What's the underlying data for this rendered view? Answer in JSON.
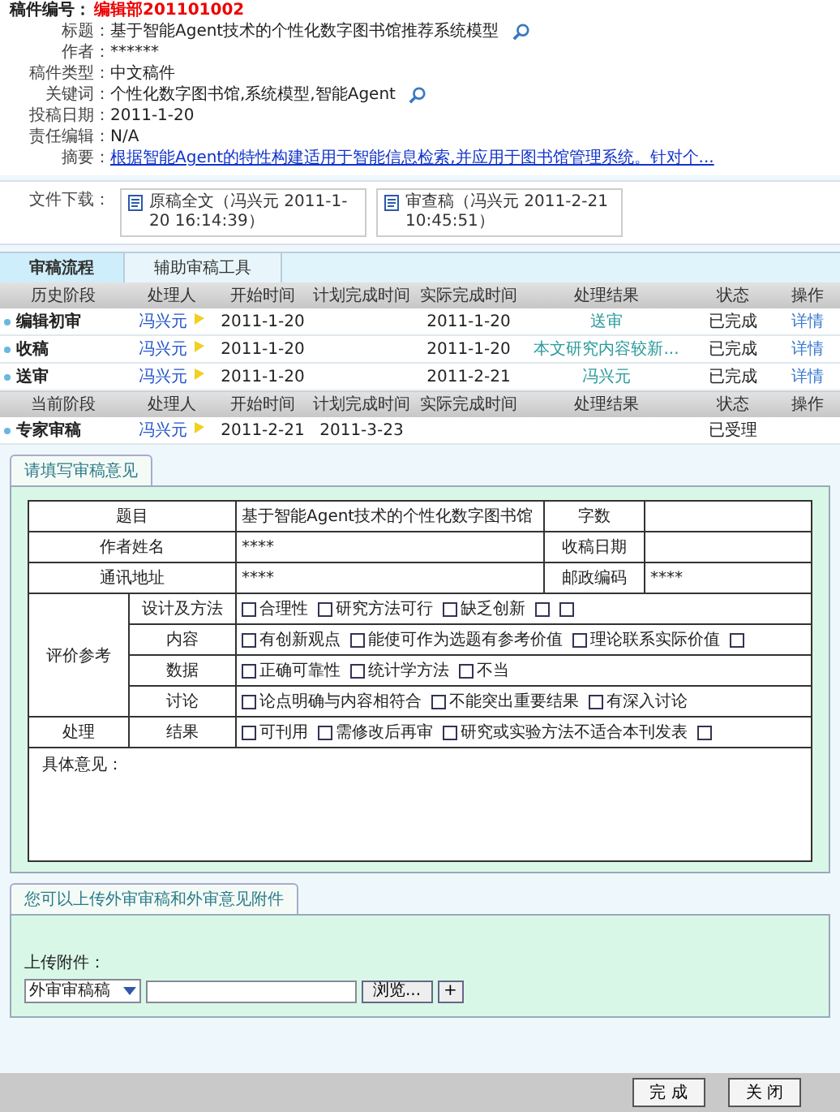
{
  "header": {
    "label": "稿件编号：",
    "number": "编辑部201101002"
  },
  "info": [
    {
      "label": "标题：",
      "value": "基于智能Agent技术的个性化数字图书馆推荐系统模型",
      "kind": "with_icon"
    },
    {
      "label": "作者：",
      "value": "******",
      "kind": "plain"
    },
    {
      "label": "稿件类型：",
      "value": "中文稿件",
      "kind": "plain"
    },
    {
      "label": "关键词：",
      "value": "个性化数字图书馆,系统模型,智能Agent",
      "kind": "with_icon"
    },
    {
      "label": "投稿日期：",
      "value": "2011-1-20",
      "kind": "plain"
    },
    {
      "label": "责任编辑：",
      "value": "N/A",
      "kind": "plain"
    },
    {
      "label": "摘要：",
      "value": "根据智能Agent的特性构建适用于智能信息检索,并应用于图书馆管理系统。针对个...",
      "kind": "link"
    }
  ],
  "downloads": {
    "label": "文件下载：",
    "files": [
      "原稿全文（冯兴元 2011-1-20 16:14:39）",
      "审查稿（冯兴元 2011-2-21 10:45:51）"
    ]
  },
  "tabs": [
    {
      "label": "审稿流程",
      "selected": true
    },
    {
      "label": "辅助审稿工具",
      "selected": false
    }
  ],
  "history": {
    "columns": [
      "历史阶段",
      "处理人",
      "开始时间",
      "计划完成时间",
      "实际完成时间",
      "处理结果",
      "状态",
      "操作"
    ],
    "rows": [
      {
        "stage": "编辑初审",
        "handler": "冯兴元",
        "start": "2011-1-20",
        "actual": "2011-1-20",
        "result": "送审",
        "status": "已完成",
        "action": "详情"
      },
      {
        "stage": "收稿",
        "handler": "冯兴元",
        "start": "2011-1-20",
        "actual": "2011-1-20",
        "result": "本文研究内容较新...",
        "status": "已完成",
        "action": "详情"
      },
      {
        "stage": "送审",
        "handler": "冯兴元",
        "start": "2011-1-20",
        "actual": "2011-2-21",
        "result": "冯兴元",
        "status": "已完成",
        "action": "详情"
      }
    ]
  },
  "current": {
    "columns": [
      "当前阶段",
      "处理人",
      "开始时间",
      "计划完成时间",
      "实际完成时间",
      "处理结果",
      "状态",
      "操作"
    ],
    "rows": [
      {
        "stage": "专家审稿",
        "handler": "冯兴元",
        "start": "2011-2-21",
        "planned": "2011-3-23",
        "status": "已受理"
      }
    ]
  },
  "review_form": {
    "tab": "请填写审稿意见",
    "info_rows": [
      {
        "label": "题目",
        "value": "基于智能Agent技术的个性化数字图书馆",
        "label2": "字数"
      },
      {
        "label": "作者姓名",
        "value": "****",
        "label2": "收稿日期"
      },
      {
        "label": "通讯地址",
        "value": "****",
        "label2": "邮政编码",
        "value2": "****"
      }
    ],
    "evaluation": {
      "group_label": "评价参考",
      "criteria": [
        {
          "name": "设计及方法",
          "options": [
            {
              "label": "合理性",
              "checked": false
            },
            {
              "label": "研究方法可行",
              "checked": false
            },
            {
              "label": "缺乏创新",
              "checked": false
            },
            {
              "checked": false
            },
            {
              "checked": false
            }
          ]
        },
        {
          "name": "内容",
          "options": [
            {
              "label": "有创新观点",
              "checked": false
            },
            {
              "label": "能使可作为选题有参考价值",
              "checked": false
            },
            {
              "label": "理论联系实际价值",
              "checked": false
            },
            {
              "checked": false
            }
          ]
        },
        {
          "name": "数据",
          "options": [
            {
              "label": "正确可靠性",
              "checked": false
            },
            {
              "label": "统计学方法",
              "checked": false
            },
            {
              "label": "不当",
              "checked": false
            }
          ]
        },
        {
          "name": "讨论",
          "options": [
            {
              "label": "论点明确与内容相符合",
              "checked": false
            },
            {
              "label": "不能突出重要结果",
              "checked": false
            },
            {
              "label": "有深入讨论",
              "checked": false
            }
          ]
        }
      ]
    },
    "conclusion": {
      "group_label": "处理",
      "name": "结果",
      "options": [
        {
          "label": "可刊用",
          "checked": false
        },
        {
          "label": "需修改后再审",
          "checked": false
        },
        {
          "label": "研究或实验方法不适合本刊发表",
          "checked": false
        },
        {
          "checked": false
        }
      ]
    },
    "comments_label": "具体意见："
  },
  "upload": {
    "tab": "您可以上传外审审稿和外审意见附件",
    "label": "上传附件：",
    "select": "外审审稿稿",
    "browse": "浏览...",
    "add": "+"
  },
  "buttons": [
    "完 成",
    "关 闭"
  ]
}
